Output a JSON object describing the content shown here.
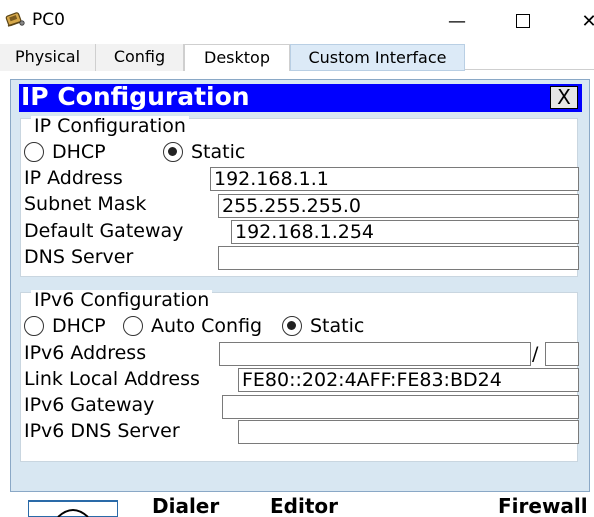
{
  "window": {
    "title": "PC0",
    "minimize_glyph": "—",
    "close_glyph": "✕",
    "icon": "pc-icon"
  },
  "tabs": [
    {
      "label": "Physical"
    },
    {
      "label": "Config"
    },
    {
      "label": "Desktop"
    },
    {
      "label": "Custom Interface"
    }
  ],
  "ip_config": {
    "title": "IP Configuration",
    "close_label": "X",
    "ipv4": {
      "legend": "IP Configuration",
      "dhcp_label": "DHCP",
      "static_label": "Static",
      "mode": "Static",
      "ip_address_label": "IP Address",
      "ip_address": "192.168.1.1",
      "subnet_mask_label": "Subnet Mask",
      "subnet_mask": "255.255.255.0",
      "default_gateway_label": "Default Gateway",
      "default_gateway": "192.168.1.254",
      "dns_server_label": "DNS Server",
      "dns_server": ""
    },
    "ipv6": {
      "legend": "IPv6 Configuration",
      "dhcp_label": "DHCP",
      "auto_config_label": "Auto Config",
      "static_label": "Static",
      "mode": "Static",
      "ipv6_address_label": "IPv6 Address",
      "ipv6_address": "",
      "prefix_separator": "/",
      "prefix_length": "",
      "link_local_label": "Link Local Address",
      "link_local": "FE80::202:4AFF:FE83:BD24",
      "ipv6_gateway_label": "IPv6 Gateway",
      "ipv6_gateway": "",
      "ipv6_dns_label": "IPv6 DNS Server",
      "ipv6_dns": ""
    }
  },
  "desktop_apps": {
    "dialer": "Dialer",
    "editor": "Editor",
    "firewall": "Firewall"
  }
}
